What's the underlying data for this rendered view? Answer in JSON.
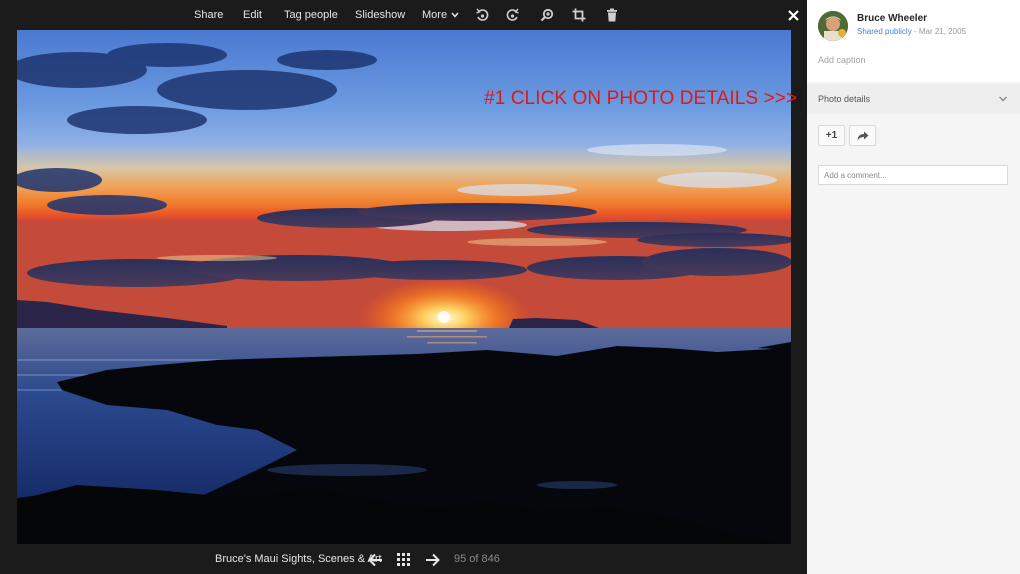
{
  "toolbar": {
    "share_label": "Share",
    "edit_label": "Edit",
    "tag_label": "Tag people",
    "slideshow_label": "Slideshow",
    "more_label": "More",
    "icons": [
      "rotate-left-icon",
      "rotate-right-icon",
      "zoom-icon",
      "crop-icon",
      "trash-icon",
      "close-icon"
    ]
  },
  "bottom": {
    "album_title": "Bruce's Maui Sights, Scenes & Art",
    "counter": "95 of 846"
  },
  "annotation": {
    "text": "#1 CLICK ON PHOTO DETAILS >>>",
    "color": "#e01818"
  },
  "panel": {
    "author": "Bruce Wheeler",
    "visibility": "Shared publicly",
    "date": "- Mar 21, 2005",
    "caption_placeholder": "Add caption",
    "details_label": "Photo details",
    "plus_label": "+1",
    "comment_placeholder": "Add a comment...",
    "accent_color": "#4a7fd8"
  }
}
